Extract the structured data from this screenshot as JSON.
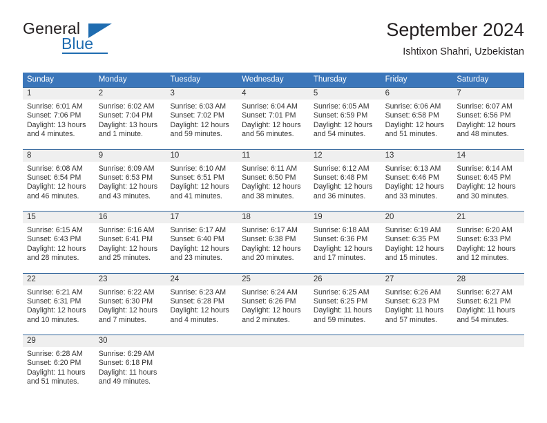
{
  "brand": {
    "name_part1": "General",
    "name_part2": "Blue",
    "accent_color": "#1f6cb0",
    "logo_icon": "triangle-icon"
  },
  "header": {
    "title": "September 2024",
    "subtitle": "Ishtixon Shahri, Uzbekistan"
  },
  "calendar": {
    "header_bg": "#3b76ba",
    "row_border_color": "#2b6098",
    "day_band_bg": "#efefef",
    "weekdays": [
      "Sunday",
      "Monday",
      "Tuesday",
      "Wednesday",
      "Thursday",
      "Friday",
      "Saturday"
    ],
    "weeks": [
      [
        {
          "day": "1",
          "sunrise": "Sunrise: 6:01 AM",
          "sunset": "Sunset: 7:06 PM",
          "daylight_line1": "Daylight: 13 hours",
          "daylight_line2": "and 4 minutes."
        },
        {
          "day": "2",
          "sunrise": "Sunrise: 6:02 AM",
          "sunset": "Sunset: 7:04 PM",
          "daylight_line1": "Daylight: 13 hours",
          "daylight_line2": "and 1 minute."
        },
        {
          "day": "3",
          "sunrise": "Sunrise: 6:03 AM",
          "sunset": "Sunset: 7:02 PM",
          "daylight_line1": "Daylight: 12 hours",
          "daylight_line2": "and 59 minutes."
        },
        {
          "day": "4",
          "sunrise": "Sunrise: 6:04 AM",
          "sunset": "Sunset: 7:01 PM",
          "daylight_line1": "Daylight: 12 hours",
          "daylight_line2": "and 56 minutes."
        },
        {
          "day": "5",
          "sunrise": "Sunrise: 6:05 AM",
          "sunset": "Sunset: 6:59 PM",
          "daylight_line1": "Daylight: 12 hours",
          "daylight_line2": "and 54 minutes."
        },
        {
          "day": "6",
          "sunrise": "Sunrise: 6:06 AM",
          "sunset": "Sunset: 6:58 PM",
          "daylight_line1": "Daylight: 12 hours",
          "daylight_line2": "and 51 minutes."
        },
        {
          "day": "7",
          "sunrise": "Sunrise: 6:07 AM",
          "sunset": "Sunset: 6:56 PM",
          "daylight_line1": "Daylight: 12 hours",
          "daylight_line2": "and 48 minutes."
        }
      ],
      [
        {
          "day": "8",
          "sunrise": "Sunrise: 6:08 AM",
          "sunset": "Sunset: 6:54 PM",
          "daylight_line1": "Daylight: 12 hours",
          "daylight_line2": "and 46 minutes."
        },
        {
          "day": "9",
          "sunrise": "Sunrise: 6:09 AM",
          "sunset": "Sunset: 6:53 PM",
          "daylight_line1": "Daylight: 12 hours",
          "daylight_line2": "and 43 minutes."
        },
        {
          "day": "10",
          "sunrise": "Sunrise: 6:10 AM",
          "sunset": "Sunset: 6:51 PM",
          "daylight_line1": "Daylight: 12 hours",
          "daylight_line2": "and 41 minutes."
        },
        {
          "day": "11",
          "sunrise": "Sunrise: 6:11 AM",
          "sunset": "Sunset: 6:50 PM",
          "daylight_line1": "Daylight: 12 hours",
          "daylight_line2": "and 38 minutes."
        },
        {
          "day": "12",
          "sunrise": "Sunrise: 6:12 AM",
          "sunset": "Sunset: 6:48 PM",
          "daylight_line1": "Daylight: 12 hours",
          "daylight_line2": "and 36 minutes."
        },
        {
          "day": "13",
          "sunrise": "Sunrise: 6:13 AM",
          "sunset": "Sunset: 6:46 PM",
          "daylight_line1": "Daylight: 12 hours",
          "daylight_line2": "and 33 minutes."
        },
        {
          "day": "14",
          "sunrise": "Sunrise: 6:14 AM",
          "sunset": "Sunset: 6:45 PM",
          "daylight_line1": "Daylight: 12 hours",
          "daylight_line2": "and 30 minutes."
        }
      ],
      [
        {
          "day": "15",
          "sunrise": "Sunrise: 6:15 AM",
          "sunset": "Sunset: 6:43 PM",
          "daylight_line1": "Daylight: 12 hours",
          "daylight_line2": "and 28 minutes."
        },
        {
          "day": "16",
          "sunrise": "Sunrise: 6:16 AM",
          "sunset": "Sunset: 6:41 PM",
          "daylight_line1": "Daylight: 12 hours",
          "daylight_line2": "and 25 minutes."
        },
        {
          "day": "17",
          "sunrise": "Sunrise: 6:17 AM",
          "sunset": "Sunset: 6:40 PM",
          "daylight_line1": "Daylight: 12 hours",
          "daylight_line2": "and 23 minutes."
        },
        {
          "day": "18",
          "sunrise": "Sunrise: 6:17 AM",
          "sunset": "Sunset: 6:38 PM",
          "daylight_line1": "Daylight: 12 hours",
          "daylight_line2": "and 20 minutes."
        },
        {
          "day": "19",
          "sunrise": "Sunrise: 6:18 AM",
          "sunset": "Sunset: 6:36 PM",
          "daylight_line1": "Daylight: 12 hours",
          "daylight_line2": "and 17 minutes."
        },
        {
          "day": "20",
          "sunrise": "Sunrise: 6:19 AM",
          "sunset": "Sunset: 6:35 PM",
          "daylight_line1": "Daylight: 12 hours",
          "daylight_line2": "and 15 minutes."
        },
        {
          "day": "21",
          "sunrise": "Sunrise: 6:20 AM",
          "sunset": "Sunset: 6:33 PM",
          "daylight_line1": "Daylight: 12 hours",
          "daylight_line2": "and 12 minutes."
        }
      ],
      [
        {
          "day": "22",
          "sunrise": "Sunrise: 6:21 AM",
          "sunset": "Sunset: 6:31 PM",
          "daylight_line1": "Daylight: 12 hours",
          "daylight_line2": "and 10 minutes."
        },
        {
          "day": "23",
          "sunrise": "Sunrise: 6:22 AM",
          "sunset": "Sunset: 6:30 PM",
          "daylight_line1": "Daylight: 12 hours",
          "daylight_line2": "and 7 minutes."
        },
        {
          "day": "24",
          "sunrise": "Sunrise: 6:23 AM",
          "sunset": "Sunset: 6:28 PM",
          "daylight_line1": "Daylight: 12 hours",
          "daylight_line2": "and 4 minutes."
        },
        {
          "day": "25",
          "sunrise": "Sunrise: 6:24 AM",
          "sunset": "Sunset: 6:26 PM",
          "daylight_line1": "Daylight: 12 hours",
          "daylight_line2": "and 2 minutes."
        },
        {
          "day": "26",
          "sunrise": "Sunrise: 6:25 AM",
          "sunset": "Sunset: 6:25 PM",
          "daylight_line1": "Daylight: 11 hours",
          "daylight_line2": "and 59 minutes."
        },
        {
          "day": "27",
          "sunrise": "Sunrise: 6:26 AM",
          "sunset": "Sunset: 6:23 PM",
          "daylight_line1": "Daylight: 11 hours",
          "daylight_line2": "and 57 minutes."
        },
        {
          "day": "28",
          "sunrise": "Sunrise: 6:27 AM",
          "sunset": "Sunset: 6:21 PM",
          "daylight_line1": "Daylight: 11 hours",
          "daylight_line2": "and 54 minutes."
        }
      ],
      [
        {
          "day": "29",
          "sunrise": "Sunrise: 6:28 AM",
          "sunset": "Sunset: 6:20 PM",
          "daylight_line1": "Daylight: 11 hours",
          "daylight_line2": "and 51 minutes."
        },
        {
          "day": "30",
          "sunrise": "Sunrise: 6:29 AM",
          "sunset": "Sunset: 6:18 PM",
          "daylight_line1": "Daylight: 11 hours",
          "daylight_line2": "and 49 minutes."
        },
        {
          "day": "",
          "sunrise": "",
          "sunset": "",
          "daylight_line1": "",
          "daylight_line2": ""
        },
        {
          "day": "",
          "sunrise": "",
          "sunset": "",
          "daylight_line1": "",
          "daylight_line2": ""
        },
        {
          "day": "",
          "sunrise": "",
          "sunset": "",
          "daylight_line1": "",
          "daylight_line2": ""
        },
        {
          "day": "",
          "sunrise": "",
          "sunset": "",
          "daylight_line1": "",
          "daylight_line2": ""
        },
        {
          "day": "",
          "sunrise": "",
          "sunset": "",
          "daylight_line1": "",
          "daylight_line2": ""
        }
      ]
    ]
  }
}
